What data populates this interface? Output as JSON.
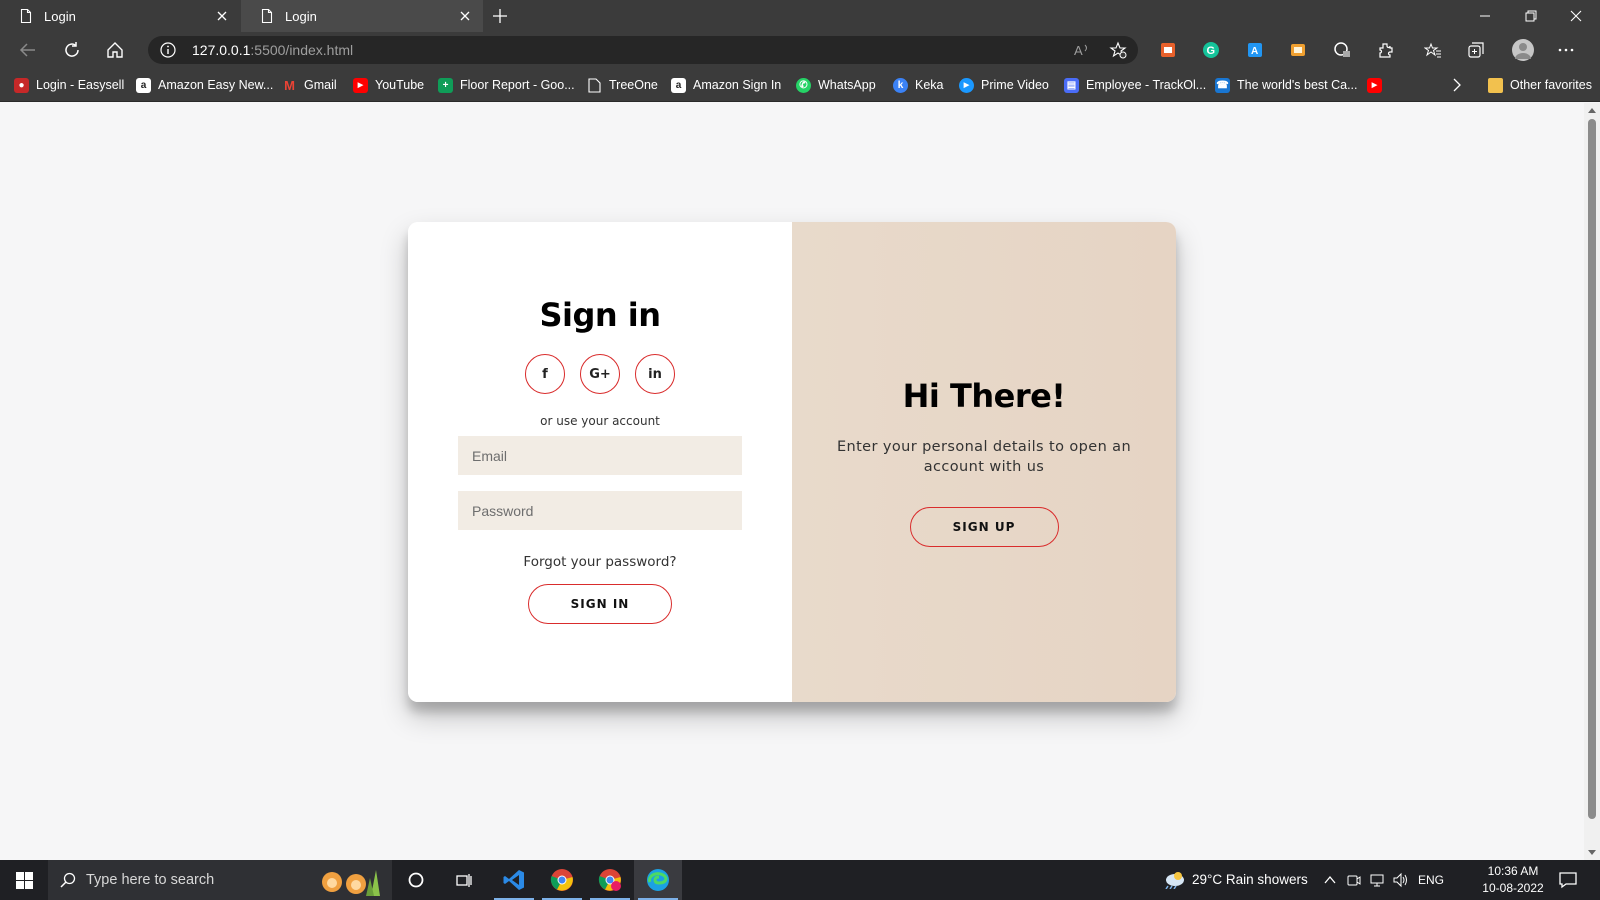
{
  "browser": {
    "tabs": [
      {
        "title": "Login",
        "active": false
      },
      {
        "title": "Login",
        "active": true
      }
    ],
    "url_host": "127.0.0.1",
    "url_path": ":5500/index.html",
    "bookmarks": [
      {
        "label": "Login - Easysell",
        "icon": "easysell-icon",
        "color": "#c62828"
      },
      {
        "label": "Amazon Easy New...",
        "icon": "amazon-icon",
        "color": "#222222"
      },
      {
        "label": "Gmail",
        "icon": "gmail-icon",
        "color": "#ea4335"
      },
      {
        "label": "YouTube",
        "icon": "youtube-icon",
        "color": "#ff0000"
      },
      {
        "label": "Floor Report - Goo...",
        "icon": "sheets-icon",
        "color": "#0f9d58"
      },
      {
        "label": "TreeOne",
        "icon": "page-icon",
        "color": "#3b3b3b"
      },
      {
        "label": "Amazon Sign In",
        "icon": "amazon-icon",
        "color": "#222222"
      },
      {
        "label": "WhatsApp",
        "icon": "whatsapp-icon",
        "color": "#25d366"
      },
      {
        "label": "Keka",
        "icon": "keka-icon",
        "color": "#3b82f6"
      },
      {
        "label": "Prime Video",
        "icon": "prime-video-icon",
        "color": "#1a98ff"
      },
      {
        "label": "Employee - TrackOl...",
        "icon": "trackol-icon",
        "color": "#4a6cf7"
      },
      {
        "label": "The world's best Ca...",
        "icon": "phone-icon",
        "color": "#1976d2"
      },
      {
        "label": "",
        "icon": "youtube-icon",
        "color": "#ff0000"
      }
    ],
    "other_favorites": "Other favorites"
  },
  "signin": {
    "title": "Sign in",
    "socials": [
      {
        "label": "f",
        "icon": "facebook-icon"
      },
      {
        "label": "G+",
        "icon": "google-plus-icon"
      },
      {
        "label": "in",
        "icon": "linkedin-icon"
      }
    ],
    "or_text": "or use your account",
    "email_placeholder": "Email",
    "password_placeholder": "Password",
    "forgot": "Forgot your password?",
    "button": "SIGN IN"
  },
  "overlay": {
    "title": "Hi There!",
    "text": "Enter your personal details to open an account with us",
    "button": "SIGN UP"
  },
  "taskbar": {
    "search_placeholder": "Type here to search",
    "weather": "29°C  Rain showers",
    "language": "ENG",
    "time": "10:36 AM",
    "date": "10-08-2022"
  },
  "colors": {
    "accent": "#d92c2c",
    "overlay_bg": "#e8dacb",
    "input_bg": "#f2ece4"
  }
}
